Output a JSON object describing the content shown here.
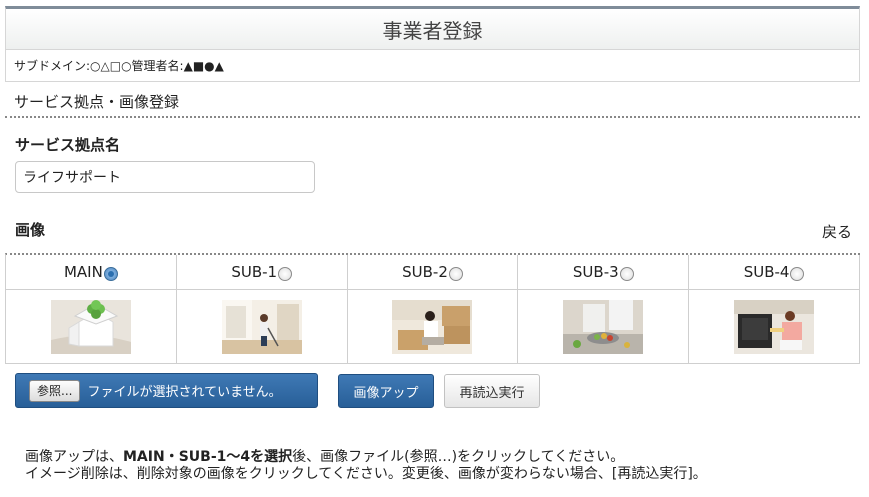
{
  "header": {
    "title": "事業者登録"
  },
  "info": {
    "text": "サブドメイン:○△□○管理者名:▲■●▲"
  },
  "section": {
    "heading": "サービス拠点・画像登録"
  },
  "service_point": {
    "label": "サービス拠点名",
    "value": "ライフサポート"
  },
  "images": {
    "label": "画像",
    "back": "戻る",
    "columns": [
      {
        "label": "MAIN",
        "selected": true,
        "thumb": "house-icon-thumbnail"
      },
      {
        "label": "SUB-1",
        "selected": false,
        "thumb": "cleaning-room-photo"
      },
      {
        "label": "SUB-2",
        "selected": false,
        "thumb": "moving-boxes-photo"
      },
      {
        "label": "SUB-3",
        "selected": false,
        "thumb": "cooking-photo"
      },
      {
        "label": "SUB-4",
        "selected": false,
        "thumb": "kitchen-cleaning-photo"
      }
    ]
  },
  "file": {
    "browse_label": "参照...",
    "status": "ファイルが選択されていません。"
  },
  "buttons": {
    "upload": "画像アップ",
    "reload": "再読込実行"
  },
  "notes": {
    "line1_pre": "画像アップは、",
    "line1_bold": "MAIN・SUB-1～4を選択",
    "line1_post": "後、画像ファイル(参照…)をクリックしてください。",
    "line2": "イメージ削除は、削除対象の画像をクリックしてください。変更後、画像が変わらない場合、[再読込実行]。"
  },
  "colors": {
    "accent_blue": "#2f6aa6",
    "title_border": "#7f8c99"
  }
}
